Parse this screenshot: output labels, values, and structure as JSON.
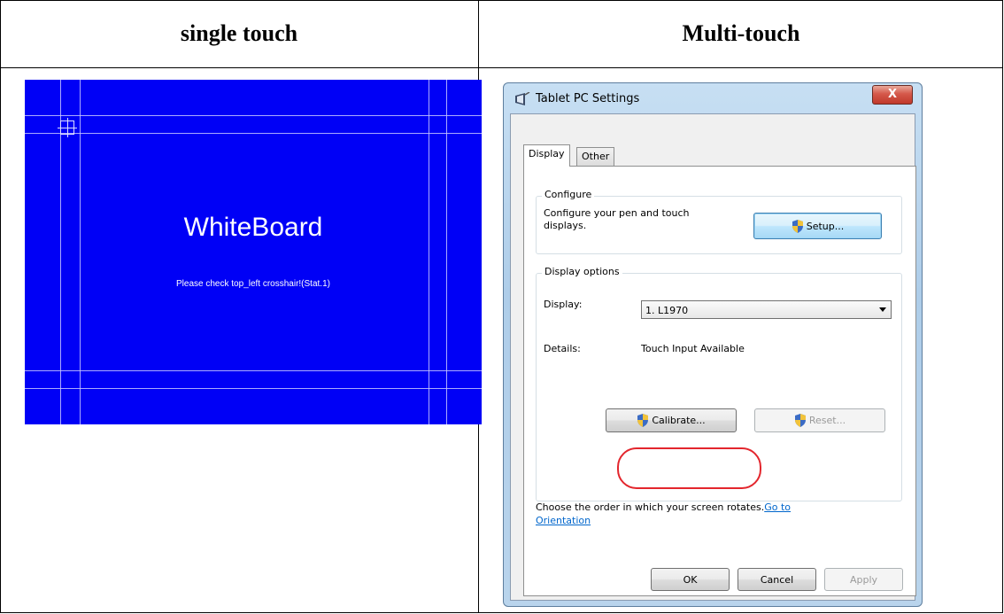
{
  "headers": {
    "left": "single touch",
    "right": "Multi-touch"
  },
  "whiteboard": {
    "title": "WhiteBoard",
    "message": "Please check top_left crosshair!(Stat.1)",
    "background_color": "#0000f6"
  },
  "dialog": {
    "title": "Tablet PC Settings",
    "close_label": "X",
    "tabs": [
      "Display",
      "Other"
    ],
    "configure": {
      "group_label": "Configure",
      "description": "Configure your pen and touch displays.",
      "setup_button": "Setup..."
    },
    "display_options": {
      "group_label": "Display options",
      "display_label": "Display:",
      "display_value": "1. L1970",
      "details_label": "Details:",
      "details_value": "Touch Input Available",
      "calibrate_button": "Calibrate...",
      "reset_button": "Reset..."
    },
    "orientation_text": "Choose the order in which your screen rotates.",
    "orientation_link": "Go to Orientation",
    "buttons": {
      "ok": "OK",
      "cancel": "Cancel",
      "apply": "Apply"
    },
    "highlight_color": "#e3262d"
  }
}
